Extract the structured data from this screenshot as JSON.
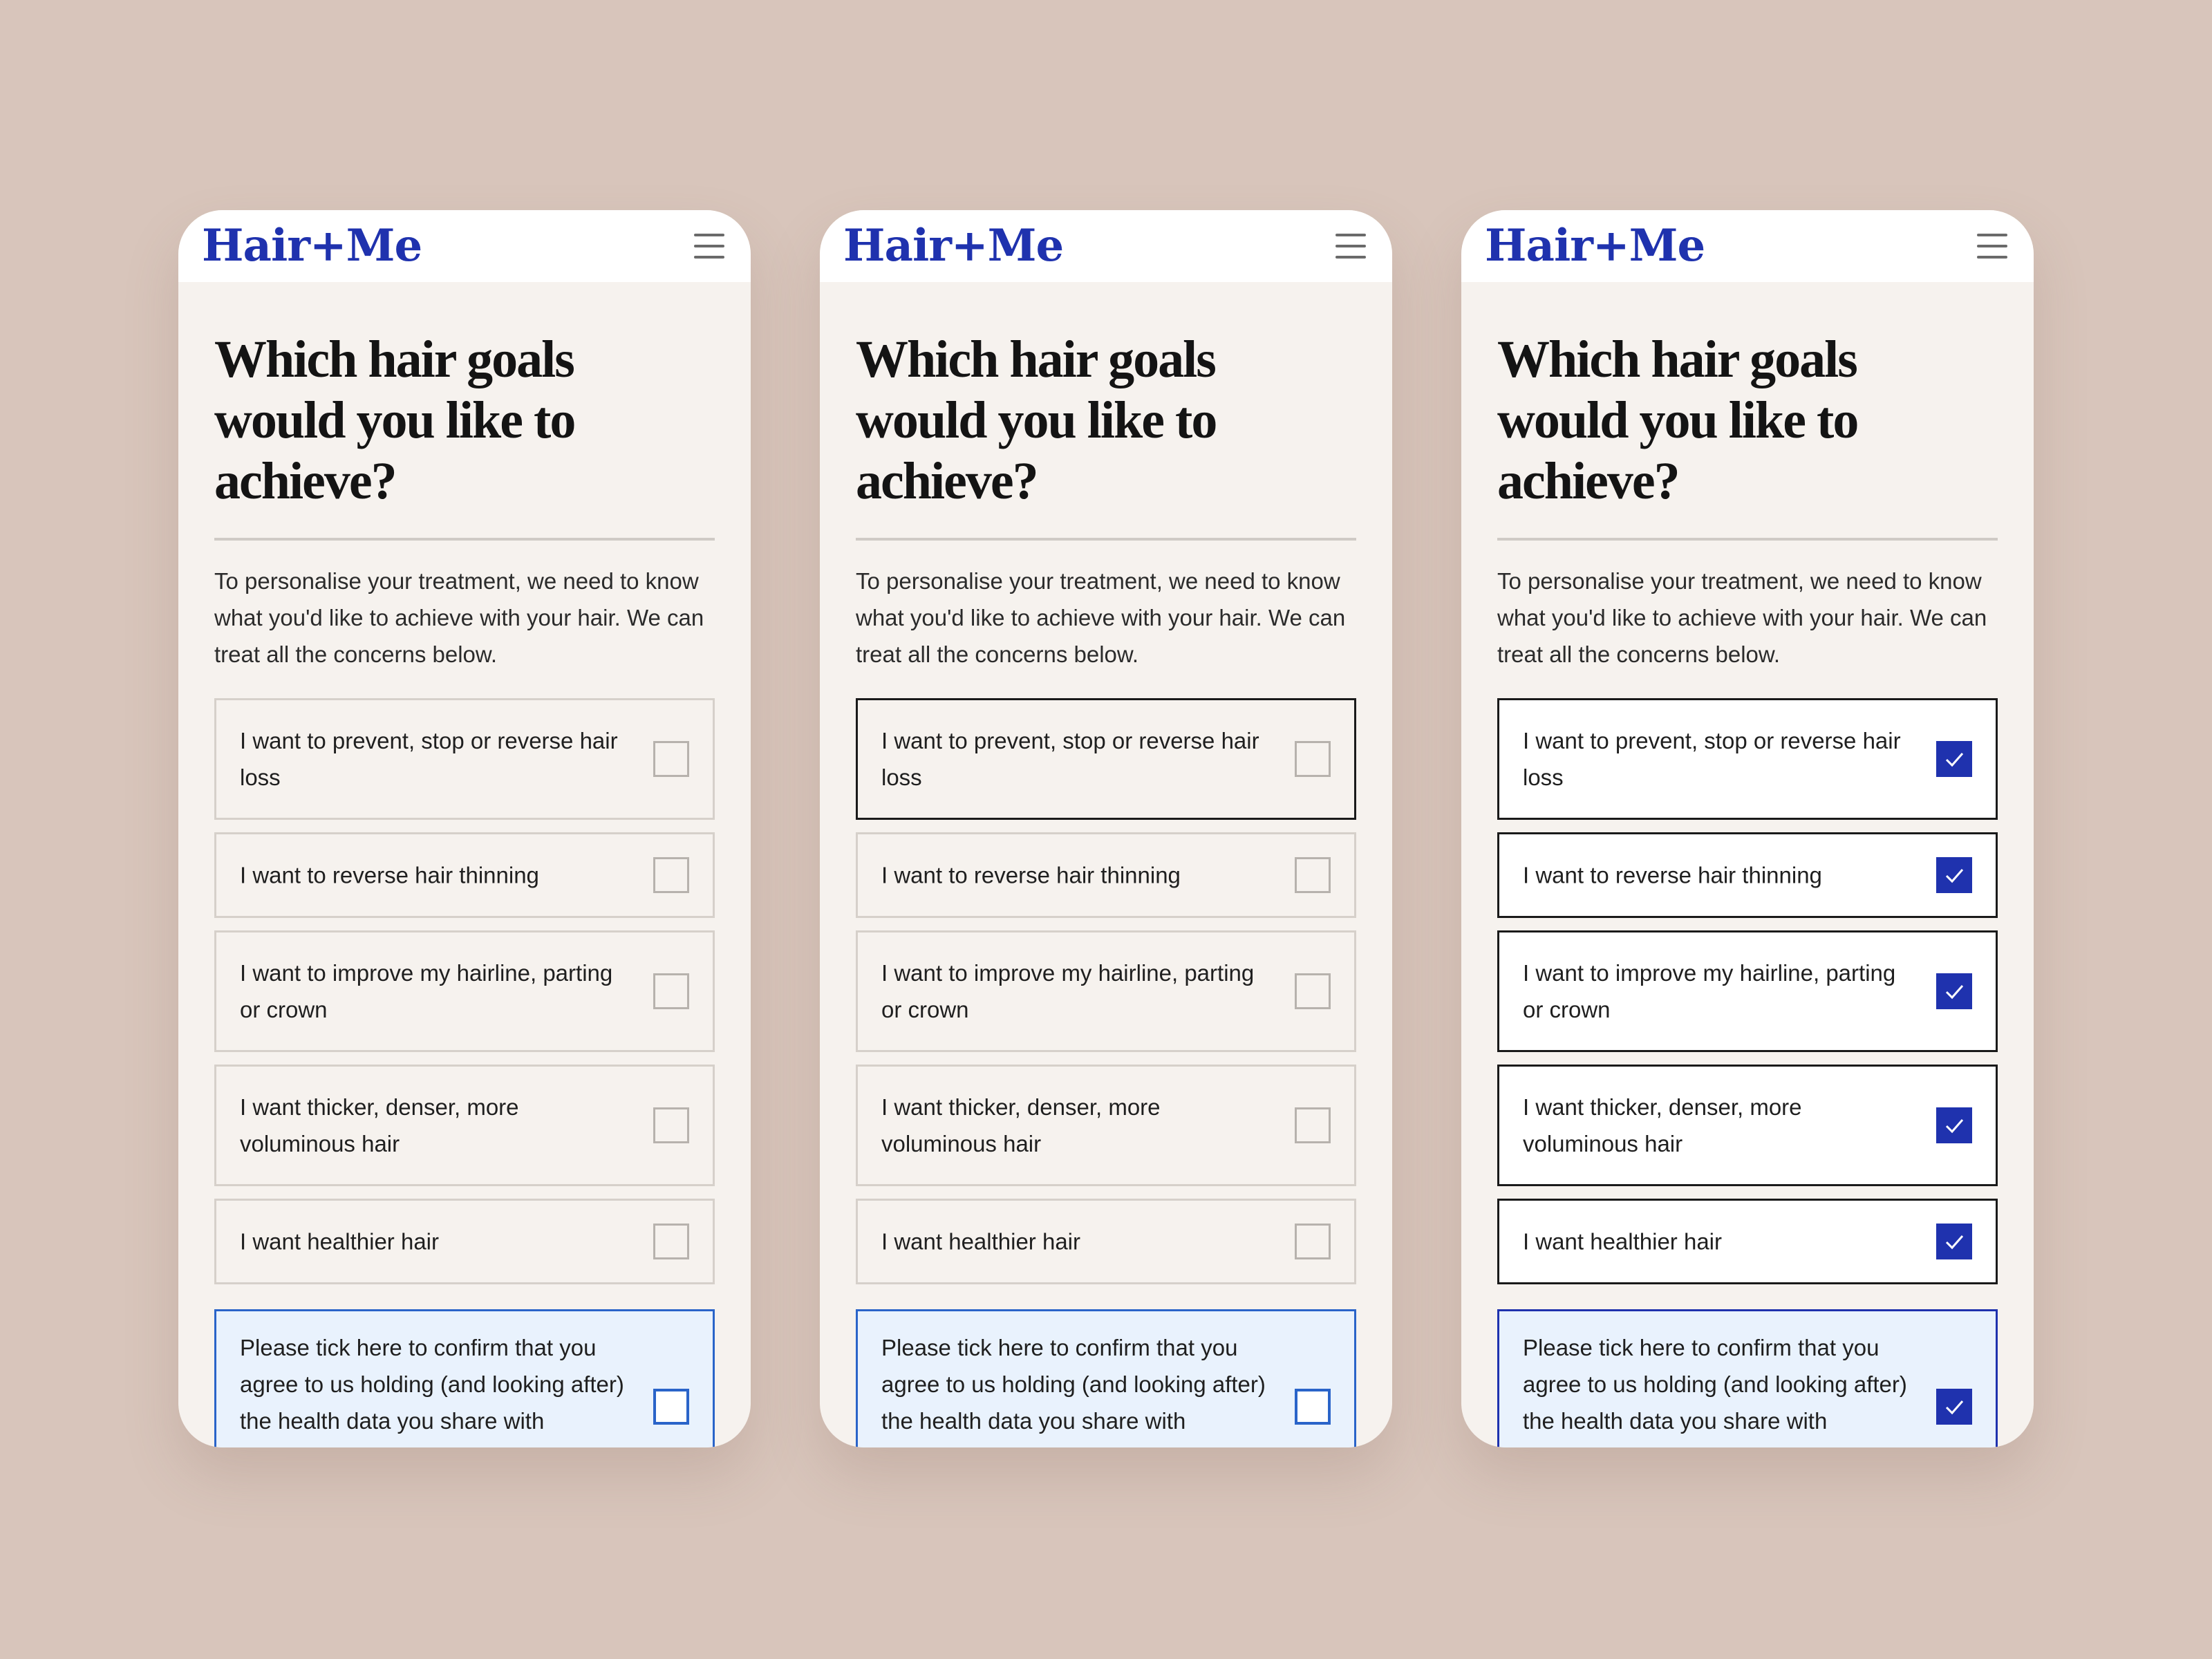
{
  "brand": {
    "logo_text": "Hair+Me",
    "color": "#1f32ae"
  },
  "page": {
    "heading": "Which hair goals would you like to achieve?",
    "intro": "To personalise your treatment, we need to know what you'd like to achieve with your hair. We can treat all the concerns below.",
    "consent": "Please tick here to confirm that you agree to us holding (and looking after) the health data you share with"
  },
  "options": [
    {
      "label": "I want to prevent, stop or reverse hair loss"
    },
    {
      "label": "I want to reverse hair thinning"
    },
    {
      "label": "I want to improve my hairline, parting or crown"
    },
    {
      "label": "I want thicker, denser, more voluminous hair"
    },
    {
      "label": "I want healthier hair"
    }
  ],
  "screens": [
    {
      "state": "default",
      "checked": [
        false,
        false,
        false,
        false,
        false
      ],
      "consent_checked": false
    },
    {
      "state": "first-option-focused",
      "checked": [
        false,
        false,
        false,
        false,
        false
      ],
      "consent_checked": false
    },
    {
      "state": "all-selected",
      "checked": [
        true,
        true,
        true,
        true,
        true
      ],
      "consent_checked": true
    }
  ],
  "icons": {
    "menu": "hamburger-menu-icon",
    "checkbox": "checkbox-icon",
    "check": "checkmark-icon"
  },
  "colors": {
    "background": "#d8c5bb",
    "card": "#f6f2ee",
    "checked_fill": "#1f32ae",
    "consent_border": "#2a64c9",
    "consent_fill": "#e9f2fd"
  }
}
